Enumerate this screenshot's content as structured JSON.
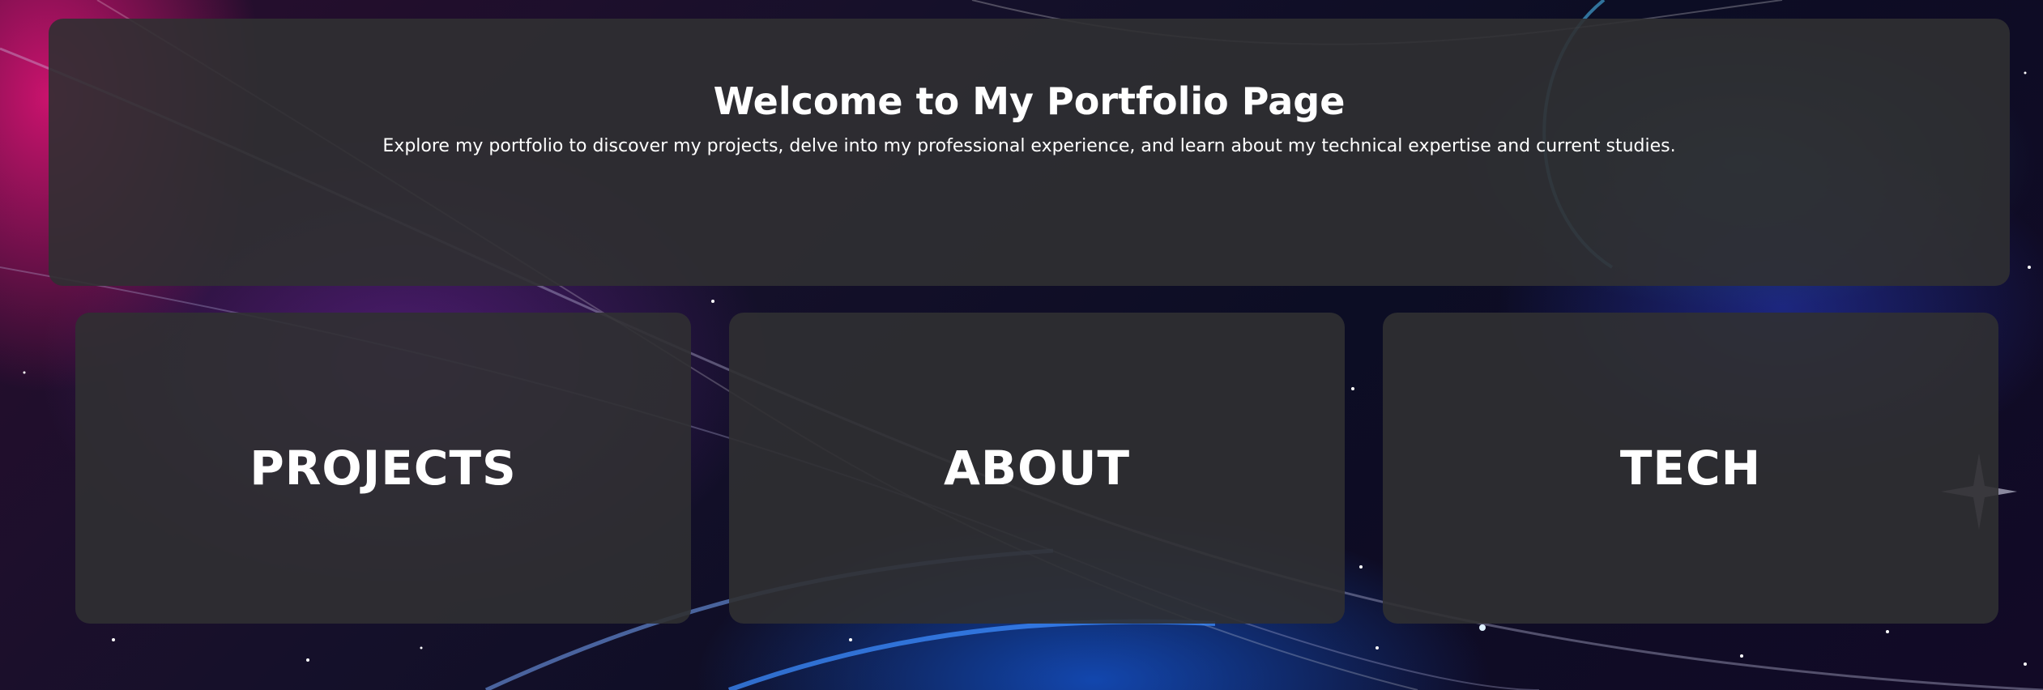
{
  "hero": {
    "title": "Welcome to My Portfolio Page",
    "subtitle": "Explore my portfolio to discover my projects, delve into my professional experience, and learn about my technical expertise and current studies."
  },
  "cards": [
    {
      "label": "PROJECTS"
    },
    {
      "label": "ABOUT"
    },
    {
      "label": "TECH"
    }
  ],
  "colors": {
    "panel": "#303032",
    "text": "#ffffff",
    "accent_pink": "#e8147a",
    "accent_blue": "#1e64ff"
  }
}
